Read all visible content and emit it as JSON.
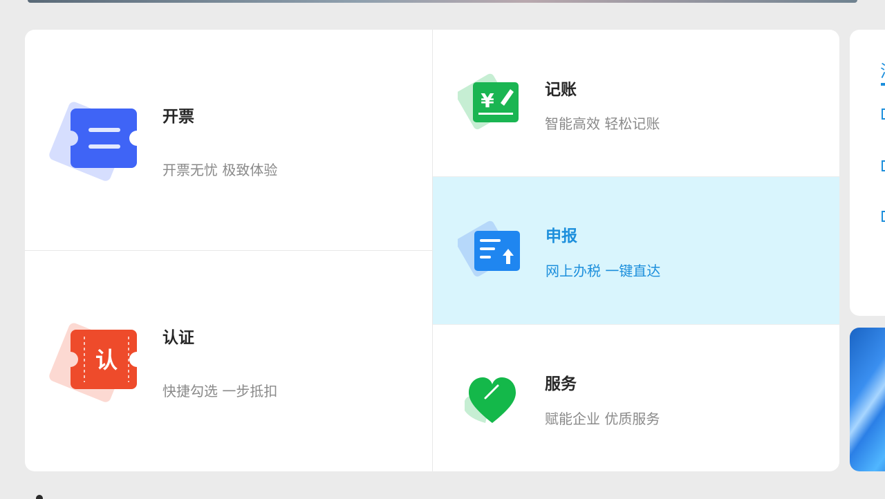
{
  "services": {
    "invoice": {
      "title": "开票",
      "subtitle": "开票无忧 极致体验"
    },
    "bookkeeping": {
      "title": "记账",
      "subtitle": "智能高效 轻松记账"
    },
    "declare": {
      "title": "申报",
      "subtitle": "网上办税 一键直达"
    },
    "certify": {
      "title": "认证",
      "subtitle": "快捷勾选 一步抵扣",
      "icon_char": "认"
    },
    "service": {
      "title": "服务",
      "subtitle": "赋能企业 优质服务"
    }
  },
  "bookkeeping_icon_glyph": "¥",
  "side_panel": {
    "tab_label": "消"
  },
  "colors": {
    "active_bg": "#d9f5fd",
    "active_text": "#1d8fdc",
    "invoice_blue": "#3f64f6",
    "bookkeeping_green": "#1ab552",
    "declare_blue": "#1f86f0",
    "certify_red": "#ee4b2b",
    "service_green": "#14b84a"
  },
  "icons": {
    "invoice": "ticket-icon",
    "bookkeeping": "yuan-pen-icon",
    "declare": "upload-doc-icon",
    "certify": "certify-ticket-icon",
    "service": "heart-icon"
  }
}
